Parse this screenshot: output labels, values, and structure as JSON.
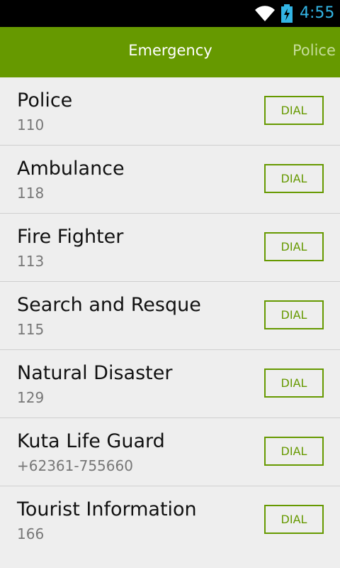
{
  "status": {
    "time": "4:55"
  },
  "colors": {
    "accent": "#669900",
    "status_time": "#33b5e5"
  },
  "tabs": [
    {
      "label": "Emergency",
      "selected": true
    },
    {
      "label": "Police",
      "selected": false
    }
  ],
  "contacts": [
    {
      "name": "Police",
      "number": "110",
      "button": "DIAL"
    },
    {
      "name": "Ambulance",
      "number": "118",
      "button": "DIAL"
    },
    {
      "name": "Fire Fighter",
      "number": "113",
      "button": "DIAL"
    },
    {
      "name": "Search and Resque",
      "number": "115",
      "button": "DIAL"
    },
    {
      "name": "Natural Disaster",
      "number": "129",
      "button": "DIAL"
    },
    {
      "name": "Kuta Life Guard",
      "number": "+62361-755660",
      "button": "DIAL"
    },
    {
      "name": "Tourist Information",
      "number": "166",
      "button": "DIAL"
    }
  ]
}
